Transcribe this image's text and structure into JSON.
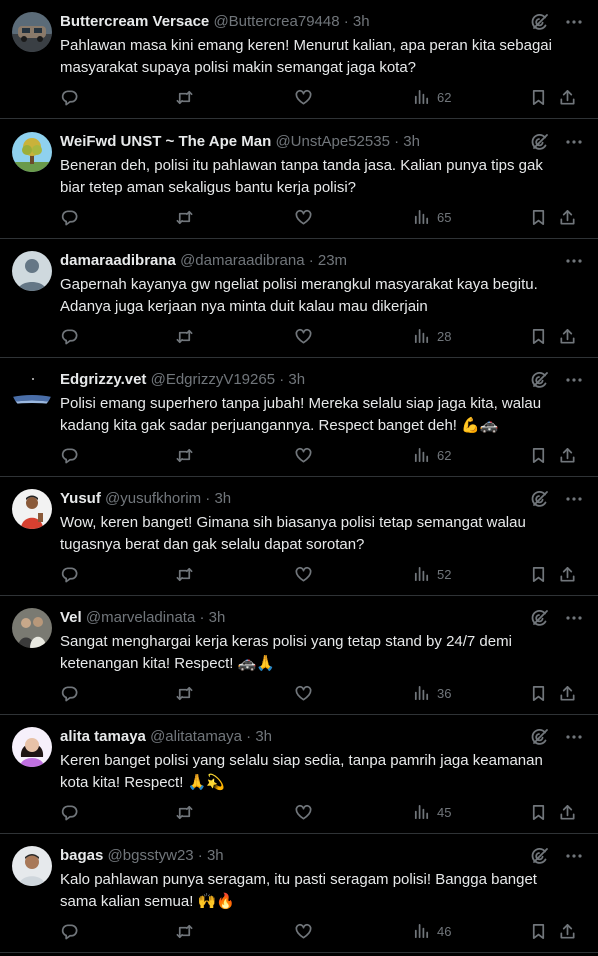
{
  "tweets": [
    {
      "name": "Buttercream Versace",
      "handle": "@Buttercrea79448",
      "time": "3h",
      "text": "Pahlawan masa kini emang keren! Menurut kalian, apa peran kita sebagai\nmasyarakat supaya polisi makin semangat jaga kota?",
      "views": "62",
      "avatar": "car-photo",
      "grok": true
    },
    {
      "name": "WeiFwd UNST ~ The Ape Man",
      "handle": "@UnstApe52535",
      "time": "3h",
      "text": "Beneran deh, polisi itu pahlawan tanpa tanda jasa. Kalian punya tips gak\nbiar tetep aman sekaligus bantu kerja polisi?",
      "views": "65",
      "avatar": "tree-photo",
      "grok": true
    },
    {
      "name": "damaraadibrana",
      "handle": "@damaraadibrana",
      "time": "23m",
      "text": "Gapernah kayanya gw ngeliat polisi merangkul masyarakat kaya begitu.\nAdanya juga kerjaan nya minta duit kalau mau dikerjain",
      "views": "28",
      "avatar": "default-avatar",
      "grok": false
    },
    {
      "name": "Edgrizzy.vet",
      "handle": "@EdgrizzyV19265",
      "time": "3h",
      "text": "Polisi emang superhero tanpa jubah! Mereka selalu siap jaga kita, walau\nkadang kita gak sadar perjuangannya. Respect banget deh! 💪🚓",
      "views": "62",
      "avatar": "horizon-photo",
      "grok": true
    },
    {
      "name": "Yusuf",
      "handle": "@yusufkhorim",
      "time": "3h",
      "text": "Wow, keren banget! Gimana sih biasanya polisi tetap semangat walau\ntugasnya berat dan gak selalu dapat sorotan?",
      "views": "52",
      "avatar": "person-red-photo",
      "grok": true
    },
    {
      "name": "Vel",
      "handle": "@marveladinata",
      "time": "3h",
      "text": "Sangat menghargai kerja keras polisi yang tetap stand by 24/7 demi\nketenangan kita! Respect! 🚓🙏",
      "views": "36",
      "avatar": "person-group-photo",
      "grok": true
    },
    {
      "name": "alita tamaya",
      "handle": "@alitatamaya",
      "time": "3h",
      "text": "Keren banget polisi yang selalu siap sedia, tanpa pamrih jaga keamanan\nkota kita! Respect! 🙏💫",
      "views": "45",
      "avatar": "person-purple-photo",
      "grok": true
    },
    {
      "name": "bagas",
      "handle": "@bgsstyw23",
      "time": "3h",
      "text": "Kalo pahlawan punya seragam, itu pasti seragam polisi! Bangga banget\nsama kalian semua! 🙌🔥",
      "views": "46",
      "avatar": "person-light-photo",
      "grok": true
    }
  ],
  "separator": "·",
  "colors": {
    "background": "#000000",
    "text": "#e7e9ea",
    "muted": "#71767b",
    "border": "#2f3336"
  }
}
